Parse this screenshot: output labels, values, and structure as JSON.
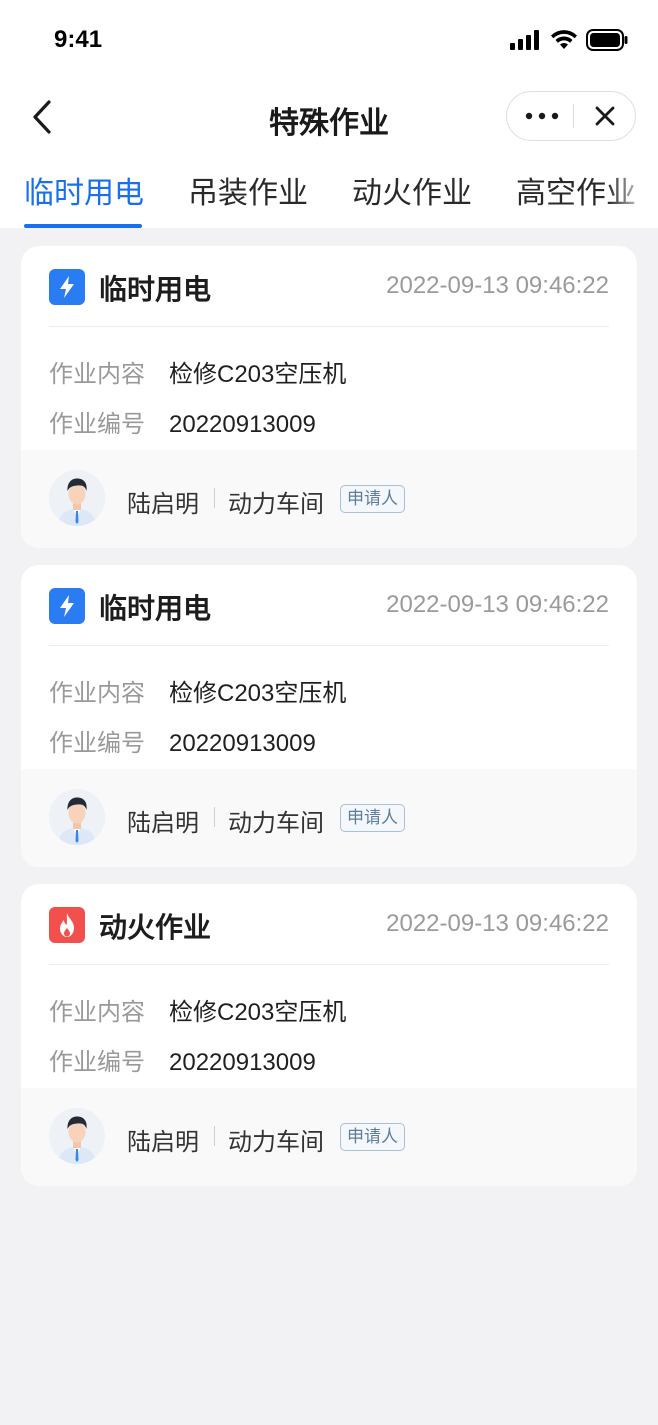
{
  "status_bar": {
    "time": "9:41"
  },
  "nav": {
    "title": "特殊作业"
  },
  "tabs": [
    {
      "label": "临时用电",
      "active": true
    },
    {
      "label": "吊装作业",
      "active": false
    },
    {
      "label": "动火作业",
      "active": false
    },
    {
      "label": "高空作业",
      "active": false
    }
  ],
  "colors": {
    "accent": "#1a6ff0",
    "electric_icon": "#2a7cf3",
    "fire_icon": "#f2504d",
    "badge_border": "#a9c0d6"
  },
  "cards": [
    {
      "type": "临时用电",
      "icon": "lightning-icon",
      "time": "2022-09-13 09:46:22",
      "content_label": "作业内容",
      "content_value": "检修C203空压机",
      "code_label": "作业编号",
      "code_value": "20220913009",
      "applicant": "陆启明",
      "department": "动力车间",
      "role_badge": "申请人"
    },
    {
      "type": "临时用电",
      "icon": "lightning-icon",
      "time": "2022-09-13 09:46:22",
      "content_label": "作业内容",
      "content_value": "检修C203空压机",
      "code_label": "作业编号",
      "code_value": "20220913009",
      "applicant": "陆启明",
      "department": "动力车间",
      "role_badge": "申请人"
    },
    {
      "type": "动火作业",
      "icon": "flame-icon",
      "time": "2022-09-13 09:46:22",
      "content_label": "作业内容",
      "content_value": "检修C203空压机",
      "code_label": "作业编号",
      "code_value": "20220913009",
      "applicant": "陆启明",
      "department": "动力车间",
      "role_badge": "申请人"
    }
  ]
}
